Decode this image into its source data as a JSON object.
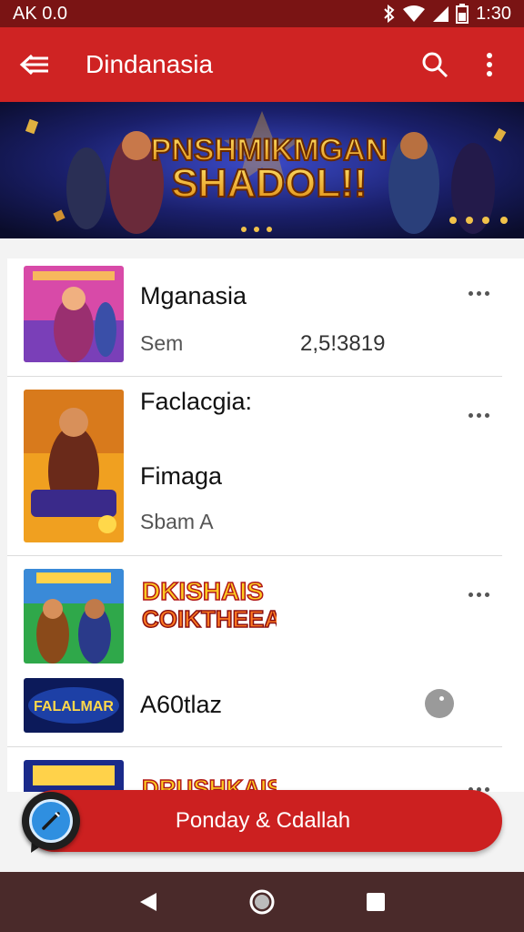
{
  "status_bar": {
    "left_text": "AK 0.0",
    "time": "1:30"
  },
  "app_bar": {
    "title": "Dindanasia"
  },
  "banner": {
    "line1": "PNSHMIKMGAN",
    "line2": "SHADOL!!"
  },
  "items": [
    {
      "title": "Mganasia",
      "subtitle": "Sem",
      "number": "2,5!3819"
    },
    {
      "title": "Faclacgia:",
      "title2": "Fimaga",
      "subtitle": "Sbam A"
    },
    {
      "logo_line1": "DKISHAIS",
      "logo_line2": "COIKTHEEAD",
      "thumb2_text": "FALALMAR",
      "title": "A60tlaz"
    },
    {
      "logo_line1": "DRUSHKAIS"
    }
  ],
  "bottom_button": {
    "label": "Ponday & Cdallah"
  },
  "colors": {
    "primary": "#cf2323",
    "status": "#7a1414",
    "nav": "#4a2a2a",
    "fab": "#2f8fe0"
  }
}
